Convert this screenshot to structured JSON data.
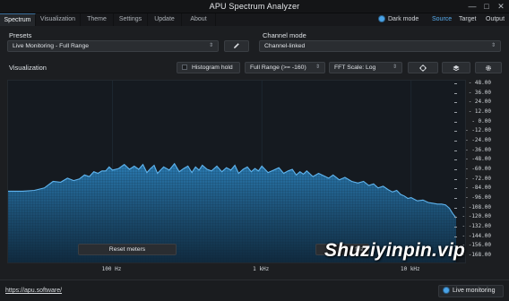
{
  "app": {
    "title": "APU Spectrum Analyzer",
    "controls": {
      "minimize": "—",
      "maximize": "□",
      "close": "✕"
    }
  },
  "tabs": [
    {
      "label": "Spectrum",
      "active": true
    },
    {
      "label": "Visualization",
      "active": false
    },
    {
      "label": "Theme",
      "active": false
    },
    {
      "label": "Settings",
      "active": false
    },
    {
      "label": "Update",
      "active": false
    },
    {
      "label": "About",
      "active": false
    }
  ],
  "topbar": {
    "dark_mode_label": "Dark mode",
    "dark_mode_on": true,
    "links": [
      "Source",
      "Target",
      "Output"
    ],
    "active_link": "Source"
  },
  "presets": {
    "label": "Presets",
    "selected": "Live Monitoring - Full Range",
    "edit_icon": "pencil-icon"
  },
  "channel_mode": {
    "label": "Channel mode",
    "selected": "Channel-linked"
  },
  "visualization": {
    "label": "Visualization",
    "histogram_hold_label": "Histogram hold",
    "histogram_hold_checked": false,
    "range_selected": "Full Range (>= -160)",
    "fft_scale_selected": "FFT Scale: Log",
    "icons": [
      "crosshair-icon",
      "layers-icon",
      "gear-icon"
    ]
  },
  "plot": {
    "reset_meters_label": "Reset meters",
    "file_button_partial": "file",
    "line_color": "#5fb4ee",
    "fill_top": "#2b7fb8",
    "fill_bottom": "#0f2a3f"
  },
  "chart_data": {
    "type": "area",
    "xlabel": "",
    "ylabel": "",
    "x_scale": "log",
    "x_ticks": [
      {
        "hz": 100,
        "label": "100 Hz"
      },
      {
        "hz": 1000,
        "label": "1 kHz"
      },
      {
        "hz": 10000,
        "label": "10 kHz"
      }
    ],
    "y_ticks": [
      "48.00",
      "36.00",
      "24.00",
      "12.00",
      "0.00",
      "-12.00",
      "-24.00",
      "-36.00",
      "-48.00",
      "-60.00",
      "-72.00",
      "-84.00",
      "-96.00",
      "-108.00",
      "-120.00",
      "-132.00",
      "-144.00",
      "-156.00",
      "-168.00"
    ],
    "ylim": [
      -168,
      48
    ],
    "series": [
      {
        "x": [
          20,
          25,
          30,
          35,
          40,
          45,
          50,
          55,
          60,
          65,
          70,
          75,
          80,
          85,
          90,
          95,
          100,
          110,
          120,
          130,
          140,
          150,
          160,
          170,
          180,
          190,
          200,
          220,
          240,
          260,
          280,
          300,
          320,
          340,
          360,
          380,
          400,
          430,
          460,
          500,
          540,
          580,
          620,
          660,
          700,
          750,
          800,
          850,
          900,
          950,
          1000,
          1100,
          1200,
          1300,
          1400,
          1500,
          1600,
          1700,
          1800,
          1900,
          2000,
          2200,
          2400,
          2600,
          2800,
          3000,
          3300,
          3600,
          4000,
          4400,
          4800,
          5200,
          5600,
          6000,
          6500,
          7000,
          7500,
          8000,
          8500,
          9000,
          9500,
          10000,
          11000,
          12000,
          13000,
          14000,
          15000,
          16000,
          17000,
          18000,
          19000,
          20000
        ],
        "y": [
          -82,
          -82,
          -81,
          -78,
          -70,
          -71,
          -66,
          -69,
          -67,
          -62,
          -64,
          -58,
          -60,
          -57,
          -57,
          -52,
          -56,
          -54,
          -49,
          -55,
          -51,
          -55,
          -49,
          -59,
          -54,
          -50,
          -60,
          -52,
          -56,
          -48,
          -58,
          -54,
          -51,
          -59,
          -52,
          -56,
          -50,
          -55,
          -57,
          -51,
          -58,
          -53,
          -56,
          -50,
          -60,
          -55,
          -52,
          -58,
          -54,
          -57,
          -51,
          -59,
          -56,
          -53,
          -60,
          -57,
          -55,
          -62,
          -58,
          -61,
          -57,
          -64,
          -60,
          -63,
          -66,
          -62,
          -68,
          -65,
          -70,
          -72,
          -70,
          -75,
          -73,
          -78,
          -76,
          -80,
          -83,
          -81,
          -86,
          -88,
          -91,
          -90,
          -94,
          -93,
          -96,
          -97,
          -98,
          -98,
          -99,
          -103,
          -110,
          -115
        ]
      }
    ]
  },
  "status": {
    "url": "https://apu.software/",
    "live_label": "Live monitoring"
  },
  "watermark": "Shuziyinpin.vip"
}
